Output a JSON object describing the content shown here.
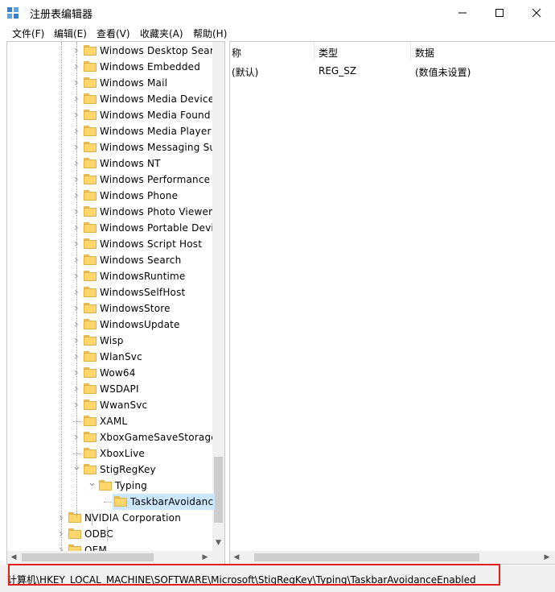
{
  "window": {
    "title": "注册表编辑器"
  },
  "menu": [
    {
      "label": "文件(F)"
    },
    {
      "label": "编辑(E)"
    },
    {
      "label": "查看(V)"
    },
    {
      "label": "收藏夹(A)"
    },
    {
      "label": "帮助(H)"
    }
  ],
  "tree": {
    "items": [
      {
        "label": "Windows Desktop Sear",
        "level": 3,
        "expandable": true,
        "open": false
      },
      {
        "label": "Windows Embedded",
        "level": 3,
        "expandable": true,
        "open": false
      },
      {
        "label": "Windows Mail",
        "level": 3,
        "expandable": true,
        "open": false
      },
      {
        "label": "Windows Media Device",
        "level": 3,
        "expandable": true,
        "open": false
      },
      {
        "label": "Windows Media Found",
        "level": 3,
        "expandable": true,
        "open": false
      },
      {
        "label": "Windows Media Player",
        "level": 3,
        "expandable": true,
        "open": false
      },
      {
        "label": "Windows Messaging Su",
        "level": 3,
        "expandable": true,
        "open": false
      },
      {
        "label": "Windows NT",
        "level": 3,
        "expandable": true,
        "open": false
      },
      {
        "label": "Windows Performance",
        "level": 3,
        "expandable": true,
        "open": false
      },
      {
        "label": "Windows Phone",
        "level": 3,
        "expandable": true,
        "open": false
      },
      {
        "label": "Windows Photo Viewer",
        "level": 3,
        "expandable": true,
        "open": false
      },
      {
        "label": "Windows Portable Devi",
        "level": 3,
        "expandable": true,
        "open": false
      },
      {
        "label": "Windows Script Host",
        "level": 3,
        "expandable": true,
        "open": false
      },
      {
        "label": "Windows Search",
        "level": 3,
        "expandable": true,
        "open": false
      },
      {
        "label": "WindowsRuntime",
        "level": 3,
        "expandable": true,
        "open": false
      },
      {
        "label": "WindowsSelfHost",
        "level": 3,
        "expandable": true,
        "open": false
      },
      {
        "label": "WindowsStore",
        "level": 3,
        "expandable": true,
        "open": false
      },
      {
        "label": "WindowsUpdate",
        "level": 3,
        "expandable": true,
        "open": false
      },
      {
        "label": "Wisp",
        "level": 3,
        "expandable": true,
        "open": false
      },
      {
        "label": "WlanSvc",
        "level": 3,
        "expandable": true,
        "open": false
      },
      {
        "label": "Wow64",
        "level": 3,
        "expandable": true,
        "open": false
      },
      {
        "label": "WSDAPI",
        "level": 3,
        "expandable": true,
        "open": false
      },
      {
        "label": "WwanSvc",
        "level": 3,
        "expandable": true,
        "open": false
      },
      {
        "label": "XAML",
        "level": 3,
        "expandable": false,
        "open": false
      },
      {
        "label": "XboxGameSaveStorage",
        "level": 3,
        "expandable": true,
        "open": false
      },
      {
        "label": "XboxLive",
        "level": 3,
        "expandable": false,
        "open": false
      },
      {
        "label": "StigRegKey",
        "level": 3,
        "expandable": true,
        "open": true
      },
      {
        "label": "Typing",
        "level": 4,
        "expandable": true,
        "open": true
      },
      {
        "label": "TaskbarAvoidanc",
        "level": 5,
        "expandable": false,
        "open": false,
        "selected": true
      },
      {
        "label": "NVIDIA Corporation",
        "level": 2,
        "expandable": true,
        "open": false
      },
      {
        "label": "ODBC",
        "level": 2,
        "expandable": true,
        "open": false
      },
      {
        "label": "OEM",
        "level": 2,
        "expandable": true,
        "open": false
      }
    ]
  },
  "list": {
    "columns": [
      {
        "label": "称"
      },
      {
        "label": "类型"
      },
      {
        "label": "数据"
      }
    ],
    "rows": [
      {
        "name": "(默认)",
        "type": "REG_SZ",
        "data": "(数值未设置)"
      }
    ]
  },
  "statusbar": {
    "path": "计算机\\HKEY_LOCAL_MACHINE\\SOFTWARE\\Microsoft\\StigRegKey\\Typing\\TaskbarAvoidanceEnabled"
  },
  "colors": {
    "highlight_border": "#e02020",
    "selection": "#cce8ff",
    "folder": "#ffd66b"
  }
}
